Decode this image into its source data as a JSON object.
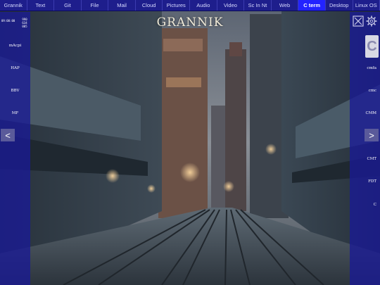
{
  "app": {
    "title": "GRANNIK"
  },
  "topbar": {
    "tabs": [
      {
        "label": "Grannik"
      },
      {
        "label": "Text"
      },
      {
        "label": "Git"
      },
      {
        "label": "File"
      },
      {
        "label": "Mail"
      },
      {
        "label": "Cloud"
      },
      {
        "label": "Pictures"
      },
      {
        "label": "Audio"
      },
      {
        "label": "Video"
      },
      {
        "label": "Sc In Nt"
      },
      {
        "label": "Web"
      },
      {
        "label": "C term"
      },
      {
        "label": "Desktop"
      },
      {
        "label": "Linux OS"
      }
    ],
    "active": "C term"
  },
  "left": {
    "clock": "09:00:00",
    "stats": [
      "990",
      "634",
      "005"
    ],
    "items": [
      {
        "label": "mAcpi"
      },
      {
        "label": "HAP"
      },
      {
        "label": "BBV"
      },
      {
        "label": "MF"
      }
    ],
    "nav": "<"
  },
  "right": {
    "icons": [
      "close-window-icon",
      "gear-icon"
    ],
    "big_label": "C",
    "items": [
      {
        "label": "cmfa"
      },
      {
        "label": "cmc"
      },
      {
        "label": "CMM"
      },
      {
        "label": "CMT"
      },
      {
        "label": "FDT"
      },
      {
        "label": "C"
      }
    ],
    "nav": ">"
  },
  "colors": {
    "topbar": "#1e1e8c",
    "active_tab": "#2323ff",
    "panel": "#191996"
  }
}
